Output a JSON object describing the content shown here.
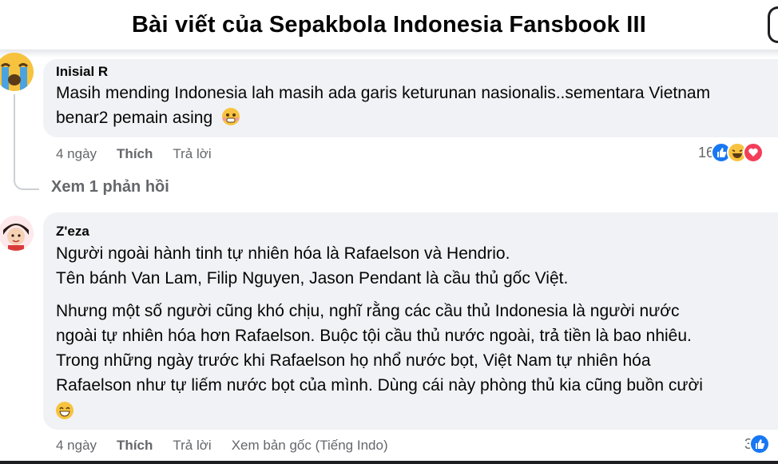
{
  "header": {
    "title": "Bài viết của Sepakbola Indonesia Fansbook III"
  },
  "comments": [
    {
      "author": "Inisial R",
      "lines": [
        "Masih mending Indonesia lah masih ada garis keturunan nasionalis..sementara Vietnam",
        "benar2 pemain asing"
      ],
      "time": "4 ngày",
      "like_label": "Thích",
      "reply_label": "Trả lời",
      "reaction_count": "16",
      "reaction_icons": [
        "like-reaction-icon",
        "haha-reaction-icon",
        "love-reaction-icon"
      ]
    },
    {
      "author": "Z'eza",
      "lines": [
        "Người ngoài hành tinh tự nhiên hóa là Rafaelson và Hendrio.",
        "Tên bánh Van Lam, Filip Nguyen, Jason Pendant là cầu thủ gốc Việt.",
        "Nhưng một số người cũng khó chịu, nghĩ rằng các cầu thủ Indonesia là người nước",
        "ngoài tự nhiên hóa hơn Rafaelson. Buộc tội cầu thủ nước ngoài, trả tiền là bao nhiêu.",
        "Trong những ngày trước khi Rafaelson họ nhổ nước bọt, Việt Nam tự nhiên hóa",
        "Rafaelson như tự liếm nước bọt của mình. Dùng cái này phòng thủ kia cũng buồn cười"
      ],
      "time": "4 ngày",
      "like_label": "Thích",
      "reply_label": "Trả lời",
      "see_original_label": "Xem bản gốc (Tiếng Indo)",
      "reaction_count": "3",
      "reaction_icons": [
        "like-reaction-icon"
      ]
    }
  ],
  "view_replies_label": "Xem 1 phản hồi",
  "colors": {
    "bubble": "#f0f2f5",
    "meta_text": "#65676b",
    "like_blue": "#1877f2",
    "love_red": "#f33e58",
    "emoji_yellow": "#f7c33e"
  }
}
